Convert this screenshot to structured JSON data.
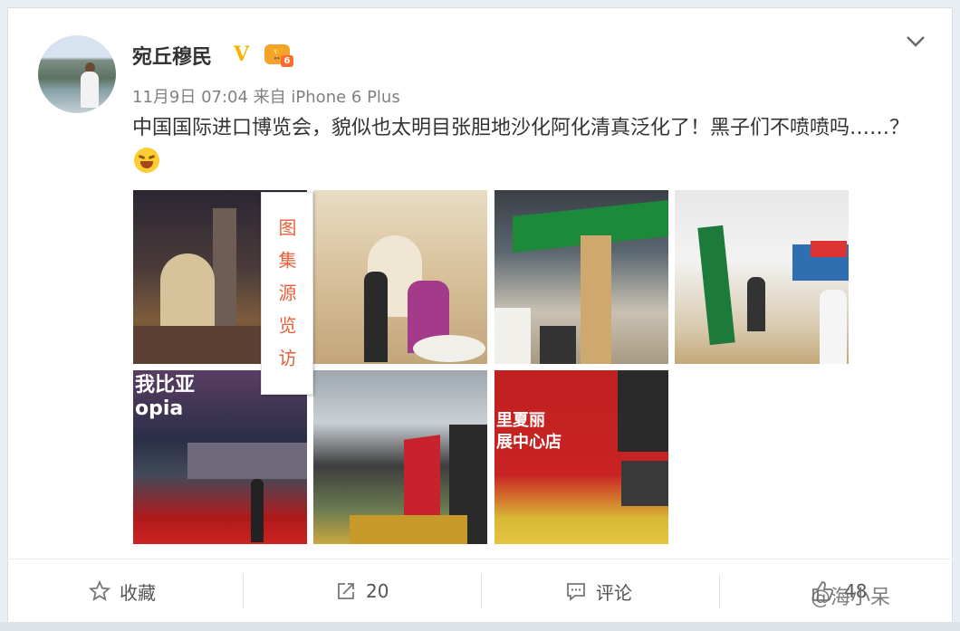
{
  "post": {
    "user_name": "宛丘穆民",
    "verified_mark": "V",
    "level_badge": "6",
    "time": "11月9日 07:04",
    "source_prefix": "来自",
    "source": "iPhone 6 Plus",
    "text": "中国国际进口博览会，貌似也太明目张胆地沙化阿化清真泛化了！黑子们不喷喷吗……？",
    "emoji": "laughing-emoji"
  },
  "gallery": {
    "tag": "图集源览访",
    "photos": [
      {
        "label": "",
        "caption": ""
      },
      {
        "label": "",
        "caption": ""
      },
      {
        "label": "",
        "caption": ""
      },
      {
        "label": "",
        "caption": ""
      },
      {
        "label": "我比亚\nopia",
        "caption": ""
      },
      {
        "label": "",
        "caption": ""
      },
      {
        "label": "里夏丽\n展中心店",
        "caption": ""
      }
    ]
  },
  "actions": {
    "favorite": "收藏",
    "repost_count": "20",
    "comment": "评论",
    "like_count": "48"
  },
  "watermark": "@海小呆",
  "colors": {
    "accent": "#e8603c",
    "verified": "#f4b400",
    "text": "#333333",
    "meta": "#808080"
  }
}
